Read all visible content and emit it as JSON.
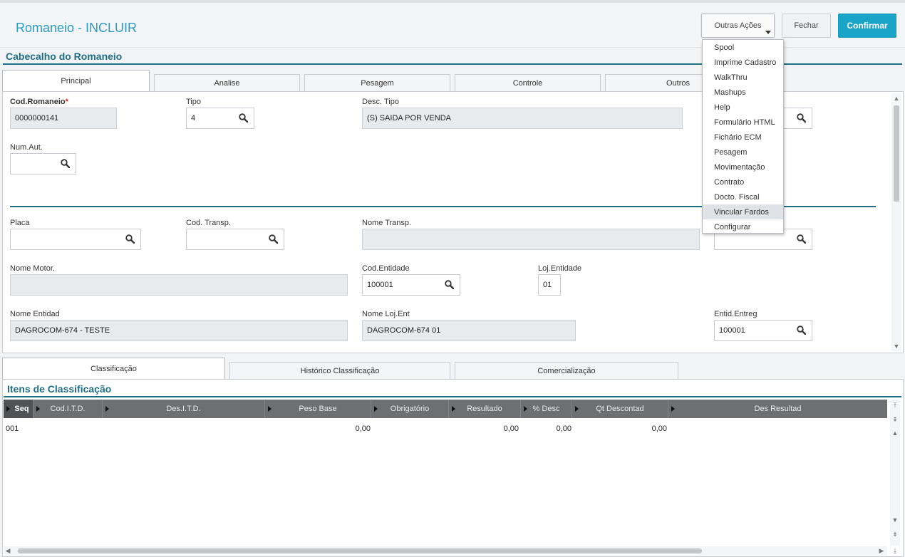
{
  "header": {
    "title": "Romaneio - INCLUIR",
    "outras_acoes": "Outras Ações",
    "fechar": "Fechar",
    "confirmar": "Confirmar"
  },
  "menu": {
    "items": [
      "Spool",
      "Imprime Cadastro",
      "WalkThru",
      "Mashups",
      "Help",
      "Formulário HTML",
      "Fichário ECM",
      "Pesagem",
      "Movimentação",
      "Contrato",
      "Docto. Fiscal",
      "Vincular Fardos",
      "Configurar"
    ],
    "highlighted": "Vincular Fardos"
  },
  "header_section": {
    "title": "Cabecalho do Romaneio",
    "tabs": [
      "Principal",
      "Analise",
      "Pesagem",
      "Controle",
      "Outros"
    ],
    "active_tab": "Principal"
  },
  "form": {
    "cod_romaneio": {
      "label": "Cod.Romaneio",
      "required_mark": "*",
      "value": "0000000141"
    },
    "tipo": {
      "label": "Tipo",
      "value": "4"
    },
    "desc_tipo": {
      "label": "Desc. Tipo",
      "value": "(S) SAIDA POR VENDA"
    },
    "num_aut": {
      "label": "Num.Aut.",
      "value": ""
    },
    "placa": {
      "label": "Placa",
      "value": ""
    },
    "cod_transp": {
      "label": "Cod. Transp.",
      "value": ""
    },
    "nome_transp": {
      "label": "Nome Transp.",
      "value": ""
    },
    "nome_motor": {
      "label": "Nome Motor.",
      "value": ""
    },
    "cod_entidade": {
      "label": "Cod.Entidade",
      "value": "100001"
    },
    "loj_entidade": {
      "label": "Loj.Entidade",
      "value": "01"
    },
    "nome_entidad": {
      "label": "Nome Entidad",
      "value": "DAGROCOM-674 - TESTE"
    },
    "nome_loj_ent": {
      "label": "Nome Loj.Ent",
      "value": "DAGROCOM-674 01"
    },
    "entid_entreg": {
      "label": "Entid.Entreg",
      "value": "100001"
    }
  },
  "bottom_tabs": {
    "tabs": [
      "Classificação",
      "Histórico Classificação",
      "Comercialização"
    ],
    "active_tab": "Classificação"
  },
  "grid": {
    "title": "Itens de Classificação",
    "columns": [
      "Seq",
      "Cod.I.T.D.",
      "Des.I.T.D.",
      "Peso Base",
      "Obrigatório",
      "Resultado",
      "% Desc",
      "Qt Descontad",
      "Des Resultad"
    ],
    "rows": [
      {
        "seq": "001",
        "cod_itd": "",
        "des_itd": "",
        "peso_base": "0,00",
        "obrigatorio": "",
        "resultado": "0,00",
        "desc": "0,00",
        "qt_descontad": "0,00",
        "des_resultad": ""
      }
    ]
  },
  "colors": {
    "accent": "#1aa5c8",
    "title": "#2a9cc4",
    "section": "#1f6f85",
    "grid_header": "#6d6f71"
  }
}
